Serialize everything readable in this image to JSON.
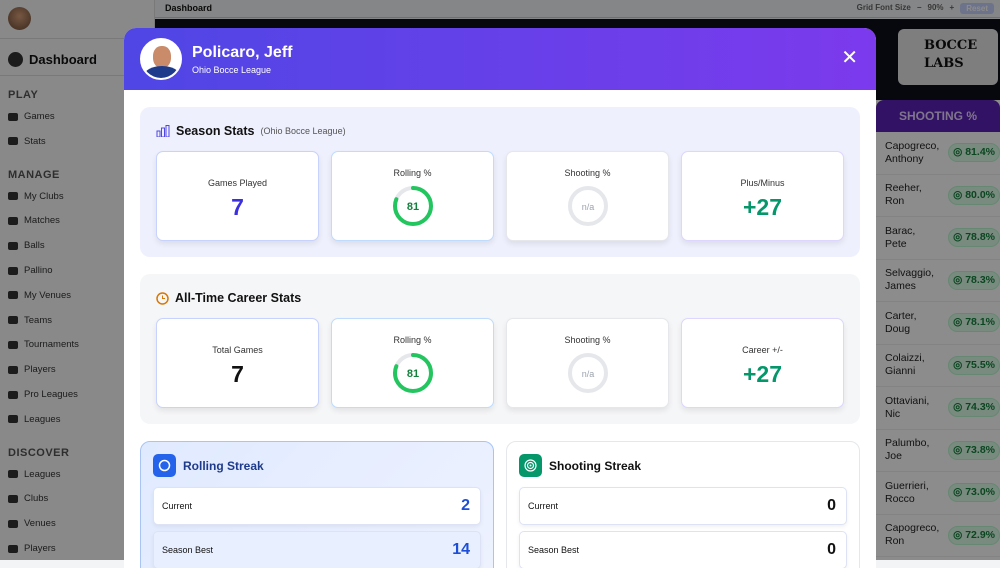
{
  "sidebar": {
    "title": "Dashboard",
    "sections": [
      {
        "label": "PLAY",
        "items": [
          "Games",
          "Stats"
        ]
      },
      {
        "label": "MANAGE",
        "items": [
          "My Clubs",
          "Matches",
          "Balls",
          "Pallino",
          "My Venues",
          "Teams",
          "Tournaments",
          "Players",
          "Pro Leagues",
          "Leagues"
        ]
      },
      {
        "label": "DISCOVER",
        "items": [
          "Leagues",
          "Clubs",
          "Venues",
          "Players"
        ]
      }
    ]
  },
  "topbar": {
    "title": "Dashboard",
    "grid_font_label": "Grid Font Size",
    "minus": "−",
    "zoom": "90%",
    "plus": "+",
    "reset": "Reset"
  },
  "logo": {
    "line1": "BOCCE",
    "line2": "LABS"
  },
  "leaderboard": {
    "header": "SHOOTING %",
    "rows": [
      {
        "name1": "Capogreco,",
        "name2": "Anthony",
        "value": "81.4%"
      },
      {
        "name1": "Reeher,",
        "name2": "Ron",
        "value": "80.0%"
      },
      {
        "name1": "Barac,",
        "name2": "Pete",
        "value": "78.8%"
      },
      {
        "name1": "Selvaggio,",
        "name2": "James",
        "value": "78.3%"
      },
      {
        "name1": "Carter,",
        "name2": "Doug",
        "value": "78.1%"
      },
      {
        "name1": "Colaizzi,",
        "name2": "Gianni",
        "value": "75.5%"
      },
      {
        "name1": "Ottaviani,",
        "name2": "Nic",
        "value": "74.3%"
      },
      {
        "name1": "Palumbo,",
        "name2": "Joe",
        "value": "73.8%"
      },
      {
        "name1": "Guerrieri,",
        "name2": "Rocco",
        "value": "73.0%"
      },
      {
        "name1": "Capogreco,",
        "name2": "Ron",
        "value": "72.9%"
      }
    ]
  },
  "modal": {
    "name": "Policaro, Jeff",
    "league": "Ohio Bocce League",
    "close": "✕",
    "season": {
      "title": "Season Stats",
      "subtitle": "(Ohio Bocce League)",
      "games_label": "Games Played",
      "games": "7",
      "rolling_label": "Rolling %",
      "rolling": "81",
      "rolling_pct": 81,
      "shooting_label": "Shooting %",
      "shooting": "n/a",
      "pm_label": "Plus/Minus",
      "pm": "+27"
    },
    "career": {
      "title": "All-Time Career Stats",
      "games_label": "Total Games",
      "games": "7",
      "rolling_label": "Rolling %",
      "rolling": "81",
      "rolling_pct": 81,
      "shooting_label": "Shooting %",
      "shooting": "n/a",
      "pm_label": "Career +/-",
      "pm": "+27"
    },
    "rolling_streak": {
      "title": "Rolling Streak",
      "current_label": "Current",
      "current": "2",
      "best_label": "Season Best",
      "best": "14"
    },
    "shooting_streak": {
      "title": "Shooting Streak",
      "current_label": "Current",
      "current": "0",
      "best_label": "Season Best",
      "best": "0"
    }
  },
  "colors": {
    "accent": "#4f46e5",
    "green": "#22c55e",
    "plus": "#059669",
    "blue": "#1d4ed8"
  }
}
